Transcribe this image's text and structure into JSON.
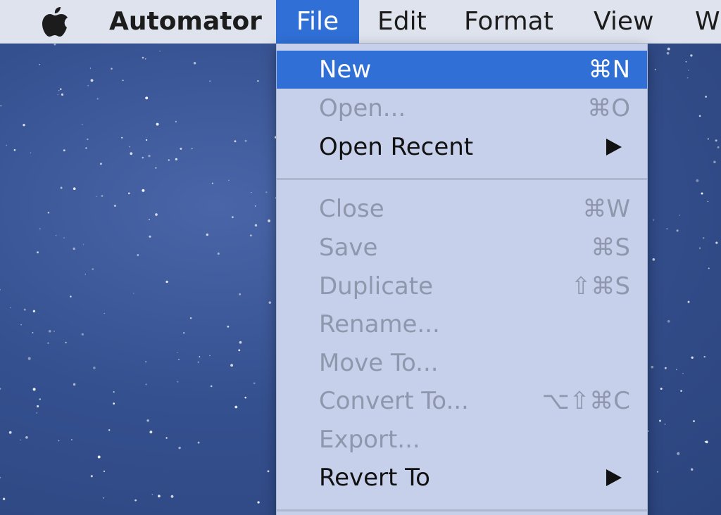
{
  "menubar": {
    "apple_icon": "apple-logo-icon",
    "app_name": "Automator",
    "menus": [
      "File",
      "Edit",
      "Format",
      "View",
      "W"
    ]
  },
  "file_menu": {
    "items": [
      {
        "label": "New",
        "shortcut": "⌘N",
        "state": "highlighted"
      },
      {
        "label": "Open...",
        "shortcut": "⌘O",
        "state": "disabled"
      },
      {
        "label": "Open Recent",
        "shortcut": "",
        "state": "enabled",
        "submenu": true
      },
      {
        "label": "Close",
        "shortcut": "⌘W",
        "state": "disabled"
      },
      {
        "label": "Save",
        "shortcut": "⌘S",
        "state": "disabled"
      },
      {
        "label": "Duplicate",
        "shortcut": "⇧⌘S",
        "state": "disabled"
      },
      {
        "label": "Rename...",
        "shortcut": "",
        "state": "disabled"
      },
      {
        "label": "Move To...",
        "shortcut": "",
        "state": "disabled"
      },
      {
        "label": "Convert To...",
        "shortcut": "⌥⇧⌘C",
        "state": "disabled"
      },
      {
        "label": "Export...",
        "shortcut": "",
        "state": "disabled"
      },
      {
        "label": "Revert To",
        "shortcut": "",
        "state": "enabled",
        "submenu": true
      }
    ]
  },
  "colors": {
    "highlight": "#2f6fd6",
    "menu_background": "#c6d0ea",
    "menubar_background": "#dfe3ee",
    "disabled_text": "#8f97ad",
    "desktop": "#35508f"
  }
}
